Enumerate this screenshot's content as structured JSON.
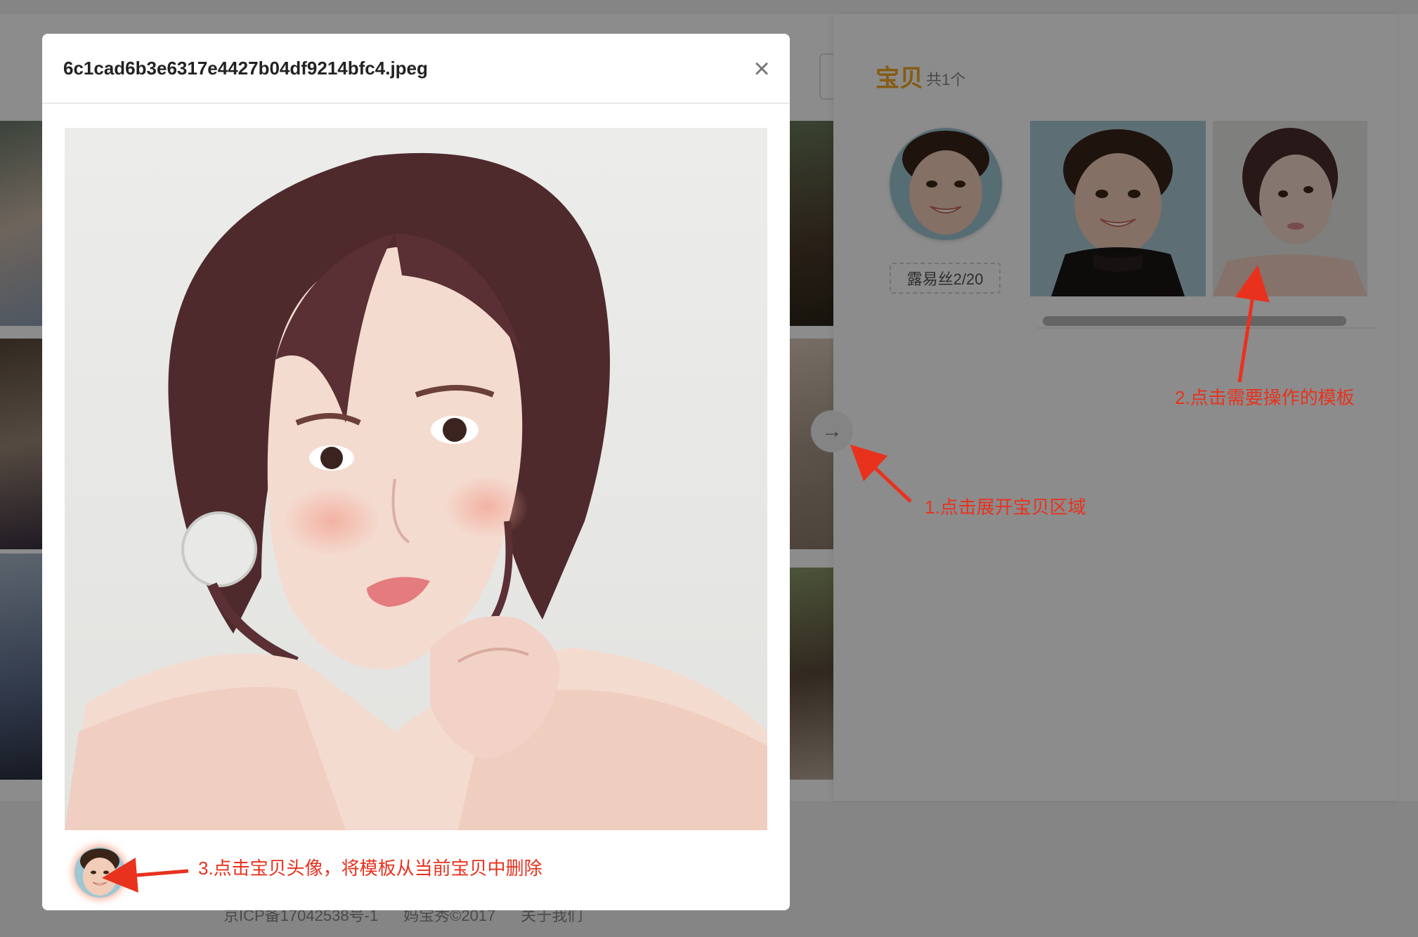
{
  "modal": {
    "title": "6c1cad6b3e6317e4427b04df9214bfc4.jpeg",
    "close_glyph": "×"
  },
  "side_panel": {
    "title": "宝贝",
    "count_text": "共1个",
    "baby_tag": "露易丝2/20",
    "toggle_glyph": "→"
  },
  "footer": {
    "links": [
      "京ICP备17042538号-1",
      "妈宝秀©2017",
      "关于我们"
    ]
  },
  "annotations": {
    "step1": "1.点击展开宝贝区域",
    "step2": "2.点击需要操作的模板",
    "step3": "3.点击宝贝头像，将模板从当前宝贝中删除"
  },
  "colors": {
    "accent": "#f5a623",
    "annotation": "#e8321e",
    "overlay": "rgba(0,0,0,0.45)"
  },
  "icons": {
    "close": "close-icon",
    "toggle": "arrow-right-icon"
  }
}
